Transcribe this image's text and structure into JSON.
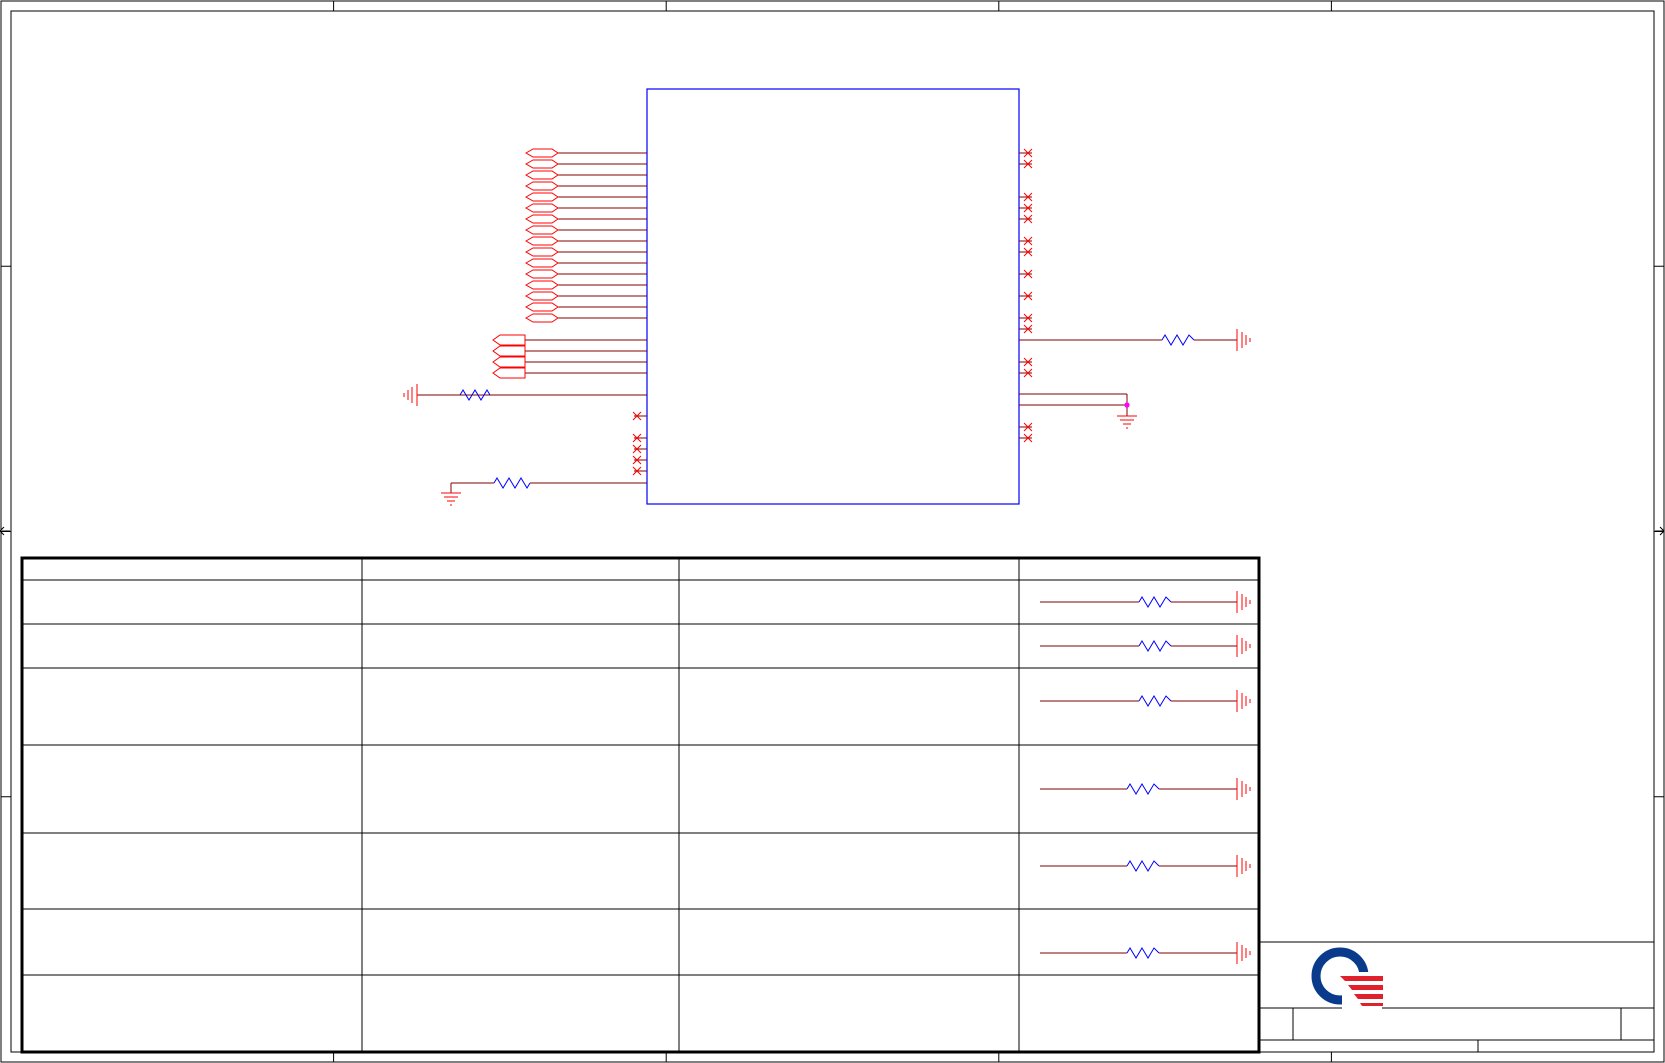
{
  "sheet": {
    "border_zones": {
      "columns": 5,
      "rows": 4
    }
  },
  "colors": {
    "frame": "#000000",
    "component_body": "#0000ff",
    "wire": "#800000",
    "connector": "#ff0000",
    "resistor": "#0000ff",
    "junction": "#ff00ff",
    "logo_blue": "#0a3a8c",
    "logo_red": "#e0202a"
  },
  "main_ic": {
    "left_signal_pins": 16,
    "left_port_pins": 4,
    "left_nc_pins": 5,
    "right_nc_pins": 16
  },
  "config_table": {
    "columns": 4,
    "rows": 7,
    "rows_with_resistor": 6
  },
  "title_block": {
    "logo": "company-logo-icon",
    "company_name": "",
    "title": "",
    "doc_number": "",
    "rev": ""
  }
}
